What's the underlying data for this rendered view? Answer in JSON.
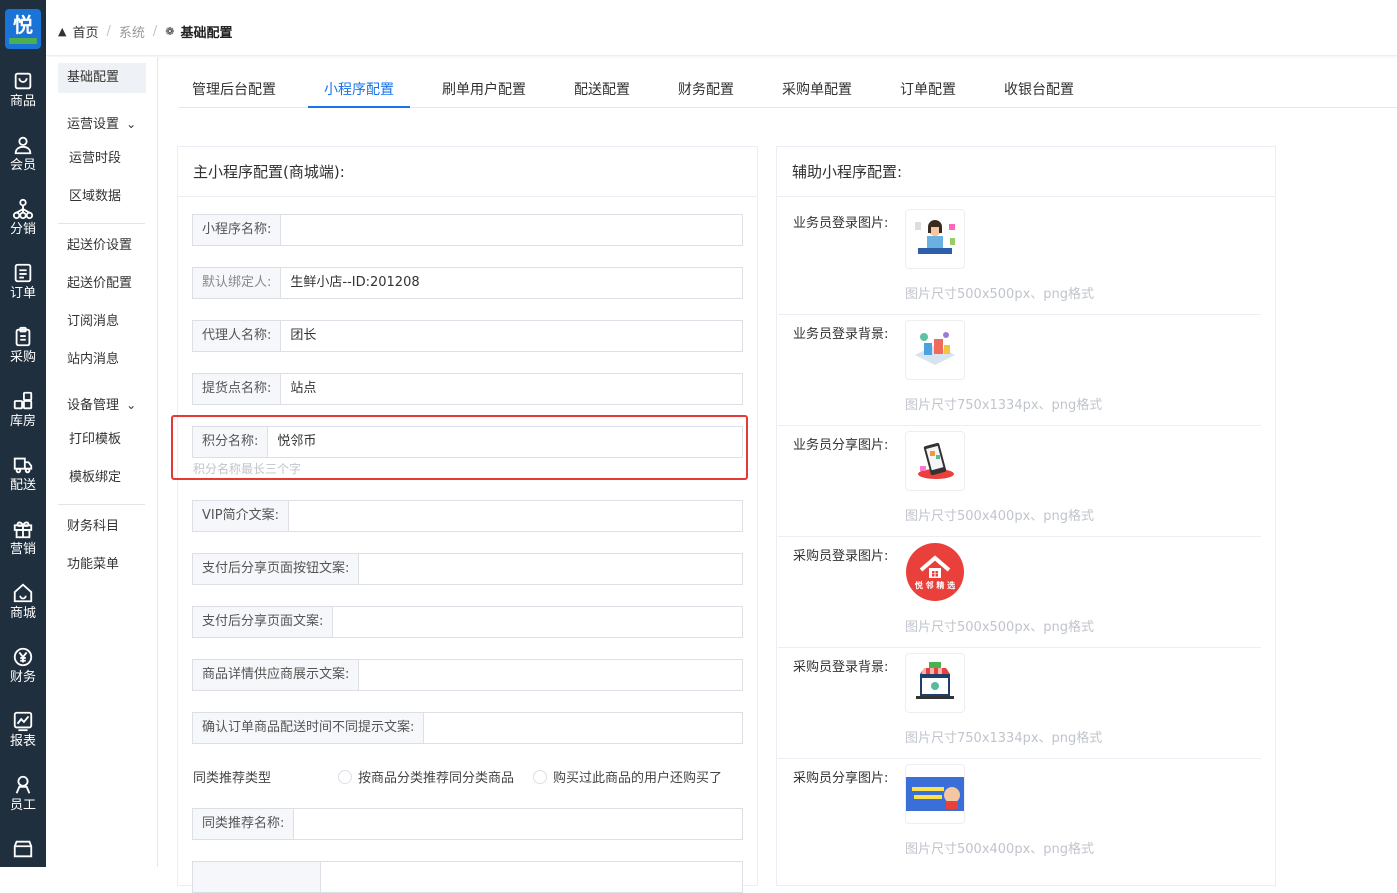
{
  "nav_rail": {
    "logo_char": "悦",
    "items": [
      {
        "label": "商品",
        "icon": "bag-icon"
      },
      {
        "label": "会员",
        "icon": "user-icon"
      },
      {
        "label": "分销",
        "icon": "hierarchy-icon"
      },
      {
        "label": "订单",
        "icon": "document-icon"
      },
      {
        "label": "采购",
        "icon": "clipboard-icon"
      },
      {
        "label": "库房",
        "icon": "grid-icon"
      },
      {
        "label": "配送",
        "icon": "truck-icon"
      },
      {
        "label": "营销",
        "icon": "gift-icon"
      },
      {
        "label": "商城",
        "icon": "home-icon"
      },
      {
        "label": "财务",
        "icon": "yen-icon"
      },
      {
        "label": "报表",
        "icon": "chart-icon"
      },
      {
        "label": "员工",
        "icon": "staff-icon"
      }
    ]
  },
  "breadcrumb": {
    "home": "首页",
    "sep": "/",
    "level2": "系统",
    "current": "基础配置",
    "home_icon": "home-icon",
    "current_icon": "gear-icon"
  },
  "side_menu": {
    "active": "基础配置",
    "group1": "运营设置",
    "group1_items": [
      "运营时段",
      "区域数据"
    ],
    "items2": [
      "起送价设置",
      "起送价配置",
      "订阅消息",
      "站内消息"
    ],
    "group2": "设备管理",
    "group2_items": [
      "打印模板",
      "模板绑定"
    ],
    "items3": [
      "财务科目",
      "功能菜单"
    ],
    "chevron": "⌄"
  },
  "tabs": [
    "管理后台配置",
    "小程序配置",
    "刷单用户配置",
    "配送配置",
    "财务配置",
    "采购单配置",
    "订单配置",
    "收银台配置"
  ],
  "active_tab": "小程序配置",
  "main_panel": {
    "title": "主小程序配置(商城端):",
    "fields": [
      {
        "label": "小程序名称:",
        "value": ""
      },
      {
        "label": "默认绑定人:",
        "value": "生鲜小店--ID:201208"
      },
      {
        "label": "代理人名称:",
        "value": "团长"
      },
      {
        "label": "提货点名称:",
        "value": "站点"
      },
      {
        "label": "积分名称:",
        "value": "悦邻币"
      },
      {
        "label": "VIP简介文案:",
        "value": ""
      },
      {
        "label": "支付后分享页面按钮文案:",
        "value": ""
      },
      {
        "label": "支付后分享页面文案:",
        "value": ""
      },
      {
        "label": "商品详情供应商展示文案:",
        "value": ""
      },
      {
        "label": "确认订单商品配送时间不同提示文案:",
        "value": ""
      },
      {
        "label": "同类推荐名称:",
        "value": ""
      }
    ],
    "points_hint": "积分名称最长三个字",
    "recommend_type": {
      "label": "同类推荐类型",
      "option1": "按商品分类推荐同分类商品",
      "option2": "购买过此商品的用户还购买了"
    }
  },
  "aux_panel": {
    "title": "辅助小程序配置:",
    "rows": [
      {
        "label": "业务员登录图片:",
        "hint": "图片尺寸500x500px、png格式"
      },
      {
        "label": "业务员登录背景:",
        "hint": "图片尺寸750x1334px、png格式"
      },
      {
        "label": "业务员分享图片:",
        "hint": "图片尺寸500x400px、png格式"
      },
      {
        "label": "采购员登录图片:",
        "hint": "图片尺寸500x500px、png格式",
        "logo_text": "悦 邻 精 选"
      },
      {
        "label": "采购员登录背景:",
        "hint": "图片尺寸750x1334px、png格式"
      },
      {
        "label": "采购员分享图片:",
        "hint": "图片尺寸500x400px、png格式"
      }
    ]
  },
  "colors": {
    "rail": "#1f2f3d",
    "accent": "#1a73e8",
    "highlight": "#e53935"
  }
}
